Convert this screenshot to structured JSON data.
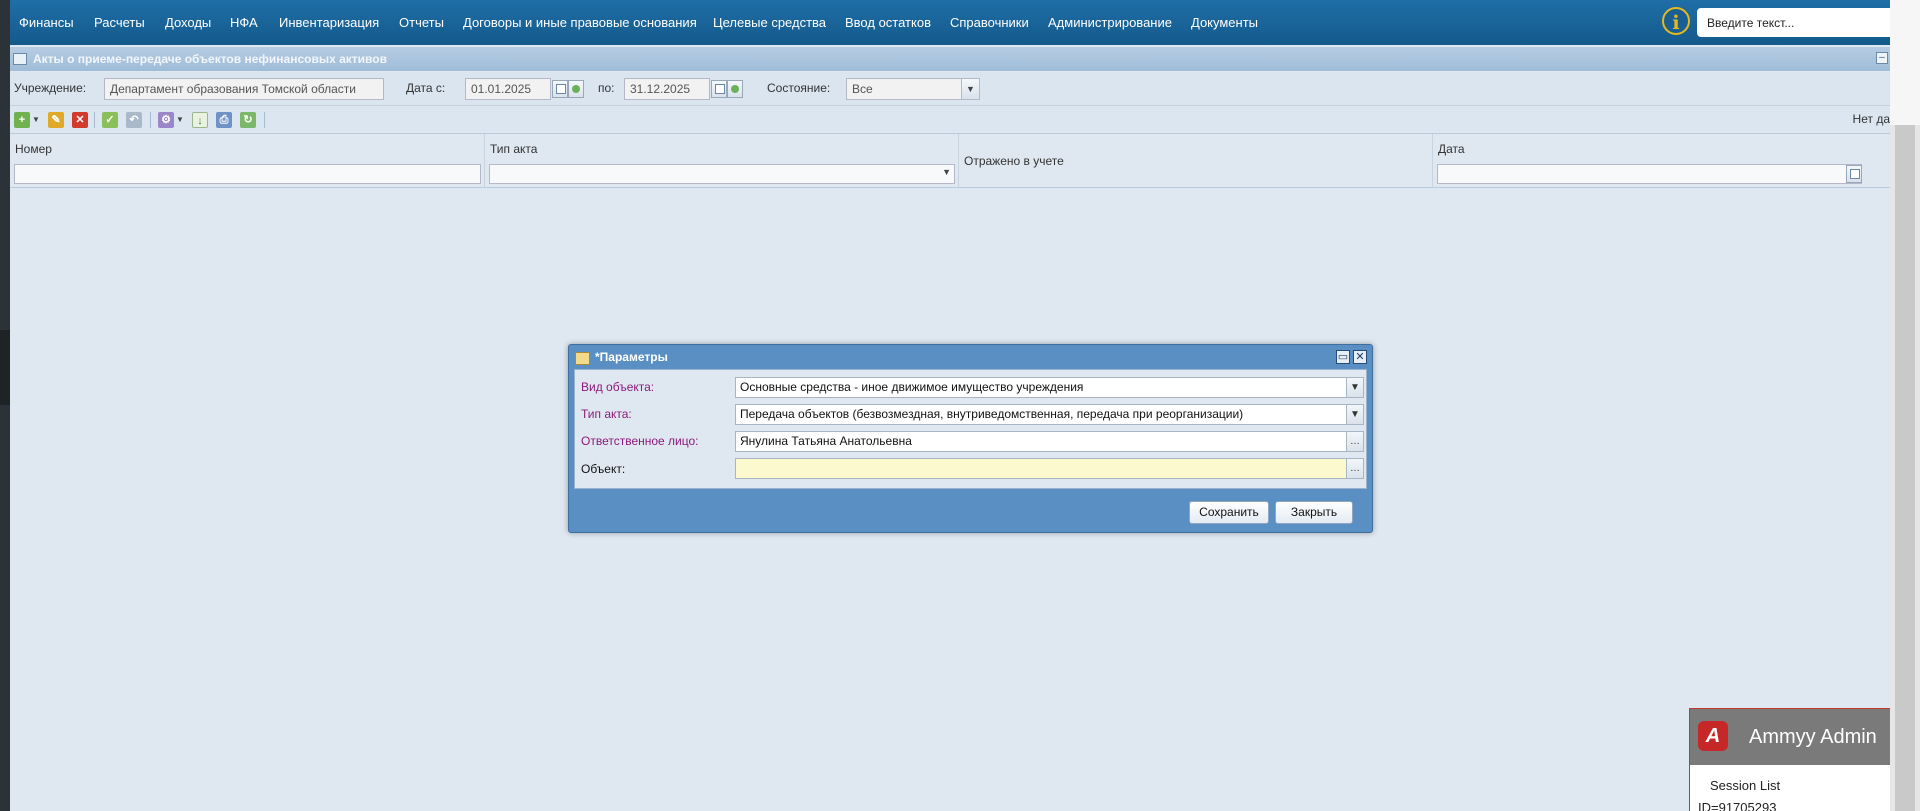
{
  "topnav": {
    "items": [
      "Финансы",
      "Расчеты",
      "Доходы",
      "НФА",
      "Инвентаризация",
      "Отчеты",
      "Договоры и иные правовые основания",
      "Целевые средства",
      "Ввод остатков",
      "Справочники",
      "Администрирование",
      "Документы"
    ],
    "search_placeholder": "Введите текст..."
  },
  "panel": {
    "title": "Акты о приеме-передаче объектов нефинансовых активов"
  },
  "filters": {
    "institution_label": "Учреждение:",
    "institution_value": "Департамент образования Томской области",
    "date_from_label": "Дата с:",
    "date_from": "01.01.2025",
    "date_to_label": "по:",
    "date_to": "31.12.2025",
    "state_label": "Состояние:",
    "state_value": "Все"
  },
  "toolbar": {
    "right_text": "Нет да"
  },
  "grid": {
    "columns": [
      "Номер",
      "Тип акта",
      "Отражено в учете",
      "Дата"
    ]
  },
  "dialog": {
    "title": "*Параметры",
    "fields": [
      {
        "label": "Вид объекта:",
        "value": "Основные средства - иное движимое имущество учреждения"
      },
      {
        "label": "Тип акта:",
        "value": "Передача объектов (безвозмездная, внутриведомственная, передача при реорганизации)"
      },
      {
        "label": "Ответственное лицо:",
        "value": "Янулина  Татьяна Анатольевна"
      },
      {
        "label": "Объект:",
        "value": ""
      }
    ],
    "save_label": "Сохранить",
    "close_label": "Закрыть"
  },
  "ammyy": {
    "title": "Ammyy Admin",
    "session_list": "Session List",
    "id_text": "ID=91705293"
  },
  "colors": {
    "nav_bg": "#1a6399",
    "required_label": "#8b1a7a",
    "dialog_frame": "#5a8fc4"
  }
}
